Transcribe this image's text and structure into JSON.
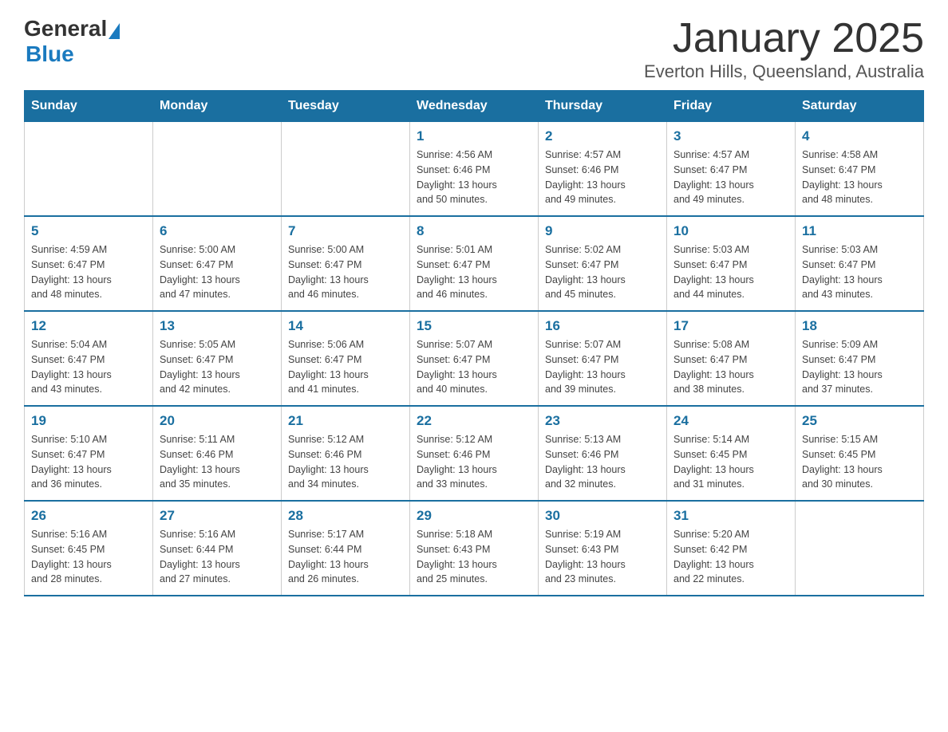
{
  "header": {
    "logo_general": "General",
    "logo_blue": "Blue",
    "title": "January 2025",
    "subtitle": "Everton Hills, Queensland, Australia"
  },
  "days_of_week": [
    "Sunday",
    "Monday",
    "Tuesday",
    "Wednesday",
    "Thursday",
    "Friday",
    "Saturday"
  ],
  "weeks": [
    [
      {
        "day": "",
        "info": ""
      },
      {
        "day": "",
        "info": ""
      },
      {
        "day": "",
        "info": ""
      },
      {
        "day": "1",
        "info": "Sunrise: 4:56 AM\nSunset: 6:46 PM\nDaylight: 13 hours\nand 50 minutes."
      },
      {
        "day": "2",
        "info": "Sunrise: 4:57 AM\nSunset: 6:46 PM\nDaylight: 13 hours\nand 49 minutes."
      },
      {
        "day": "3",
        "info": "Sunrise: 4:57 AM\nSunset: 6:47 PM\nDaylight: 13 hours\nand 49 minutes."
      },
      {
        "day": "4",
        "info": "Sunrise: 4:58 AM\nSunset: 6:47 PM\nDaylight: 13 hours\nand 48 minutes."
      }
    ],
    [
      {
        "day": "5",
        "info": "Sunrise: 4:59 AM\nSunset: 6:47 PM\nDaylight: 13 hours\nand 48 minutes."
      },
      {
        "day": "6",
        "info": "Sunrise: 5:00 AM\nSunset: 6:47 PM\nDaylight: 13 hours\nand 47 minutes."
      },
      {
        "day": "7",
        "info": "Sunrise: 5:00 AM\nSunset: 6:47 PM\nDaylight: 13 hours\nand 46 minutes."
      },
      {
        "day": "8",
        "info": "Sunrise: 5:01 AM\nSunset: 6:47 PM\nDaylight: 13 hours\nand 46 minutes."
      },
      {
        "day": "9",
        "info": "Sunrise: 5:02 AM\nSunset: 6:47 PM\nDaylight: 13 hours\nand 45 minutes."
      },
      {
        "day": "10",
        "info": "Sunrise: 5:03 AM\nSunset: 6:47 PM\nDaylight: 13 hours\nand 44 minutes."
      },
      {
        "day": "11",
        "info": "Sunrise: 5:03 AM\nSunset: 6:47 PM\nDaylight: 13 hours\nand 43 minutes."
      }
    ],
    [
      {
        "day": "12",
        "info": "Sunrise: 5:04 AM\nSunset: 6:47 PM\nDaylight: 13 hours\nand 43 minutes."
      },
      {
        "day": "13",
        "info": "Sunrise: 5:05 AM\nSunset: 6:47 PM\nDaylight: 13 hours\nand 42 minutes."
      },
      {
        "day": "14",
        "info": "Sunrise: 5:06 AM\nSunset: 6:47 PM\nDaylight: 13 hours\nand 41 minutes."
      },
      {
        "day": "15",
        "info": "Sunrise: 5:07 AM\nSunset: 6:47 PM\nDaylight: 13 hours\nand 40 minutes."
      },
      {
        "day": "16",
        "info": "Sunrise: 5:07 AM\nSunset: 6:47 PM\nDaylight: 13 hours\nand 39 minutes."
      },
      {
        "day": "17",
        "info": "Sunrise: 5:08 AM\nSunset: 6:47 PM\nDaylight: 13 hours\nand 38 minutes."
      },
      {
        "day": "18",
        "info": "Sunrise: 5:09 AM\nSunset: 6:47 PM\nDaylight: 13 hours\nand 37 minutes."
      }
    ],
    [
      {
        "day": "19",
        "info": "Sunrise: 5:10 AM\nSunset: 6:47 PM\nDaylight: 13 hours\nand 36 minutes."
      },
      {
        "day": "20",
        "info": "Sunrise: 5:11 AM\nSunset: 6:46 PM\nDaylight: 13 hours\nand 35 minutes."
      },
      {
        "day": "21",
        "info": "Sunrise: 5:12 AM\nSunset: 6:46 PM\nDaylight: 13 hours\nand 34 minutes."
      },
      {
        "day": "22",
        "info": "Sunrise: 5:12 AM\nSunset: 6:46 PM\nDaylight: 13 hours\nand 33 minutes."
      },
      {
        "day": "23",
        "info": "Sunrise: 5:13 AM\nSunset: 6:46 PM\nDaylight: 13 hours\nand 32 minutes."
      },
      {
        "day": "24",
        "info": "Sunrise: 5:14 AM\nSunset: 6:45 PM\nDaylight: 13 hours\nand 31 minutes."
      },
      {
        "day": "25",
        "info": "Sunrise: 5:15 AM\nSunset: 6:45 PM\nDaylight: 13 hours\nand 30 minutes."
      }
    ],
    [
      {
        "day": "26",
        "info": "Sunrise: 5:16 AM\nSunset: 6:45 PM\nDaylight: 13 hours\nand 28 minutes."
      },
      {
        "day": "27",
        "info": "Sunrise: 5:16 AM\nSunset: 6:44 PM\nDaylight: 13 hours\nand 27 minutes."
      },
      {
        "day": "28",
        "info": "Sunrise: 5:17 AM\nSunset: 6:44 PM\nDaylight: 13 hours\nand 26 minutes."
      },
      {
        "day": "29",
        "info": "Sunrise: 5:18 AM\nSunset: 6:43 PM\nDaylight: 13 hours\nand 25 minutes."
      },
      {
        "day": "30",
        "info": "Sunrise: 5:19 AM\nSunset: 6:43 PM\nDaylight: 13 hours\nand 23 minutes."
      },
      {
        "day": "31",
        "info": "Sunrise: 5:20 AM\nSunset: 6:42 PM\nDaylight: 13 hours\nand 22 minutes."
      },
      {
        "day": "",
        "info": ""
      }
    ]
  ]
}
